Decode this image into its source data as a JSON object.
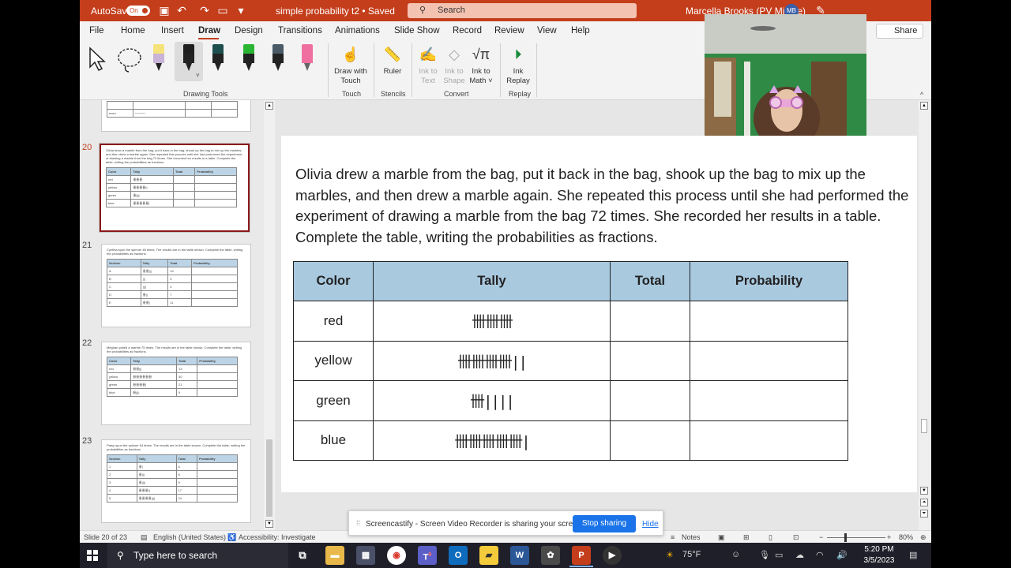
{
  "titlebar": {
    "autosave_label": "AutoSave",
    "autosave_state": "On",
    "doc_title": "simple probability t2 • Saved",
    "search_placeholder": "Search",
    "user_name": "Marcella Brooks (PV Middle)",
    "user_initials": "MB"
  },
  "menu": {
    "items": [
      "File",
      "Home",
      "Insert",
      "Draw",
      "Design",
      "Transitions",
      "Animations",
      "Slide Show",
      "Record",
      "Review",
      "View",
      "Help"
    ],
    "active": "Draw",
    "share_label": "Share"
  },
  "ribbon": {
    "groups": {
      "drawing_tools": "Drawing Tools",
      "touch": "Touch",
      "stencils": "Stencils",
      "convert": "Convert",
      "replay": "Replay"
    },
    "buttons": {
      "draw_with_touch": [
        "Draw with",
        "Touch"
      ],
      "ruler": "Ruler",
      "ink_to_text": [
        "Ink to",
        "Text"
      ],
      "ink_to_shape": [
        "Ink to",
        "Shape"
      ],
      "ink_to_math": [
        "Ink to",
        "Math ˅"
      ],
      "ink_replay": [
        "Ink",
        "Replay"
      ]
    },
    "pen_colors": [
      "#f6e27a",
      "#1f1f1f",
      "#1e4f4f",
      "#2bb534",
      "#4a5a66",
      "#ef6fa0"
    ]
  },
  "thumbnails": {
    "slide_19_partial": {
      "row_label": "even",
      "row_tally": "ꟷꟷꟷꟷ"
    },
    "slide_20": {
      "number": "20",
      "text": "Olivia drew a marble from the bag, put it back in the bag, shook up the bag to mix up the marbles, and then drew a marble again. She repeated this process until she had performed the experiment of drawing a marble from the bag 72 times. She recorded her results in a table. Complete the table, writing the probabilities as fractions.",
      "headers": [
        "Color",
        "Tally",
        "Total",
        "Probability"
      ],
      "rows": [
        "red",
        "yellow",
        "green",
        "blue"
      ]
    },
    "slide_21": {
      "number": "21",
      "text": "Cynthia spun the spinner 48 times. The results are in the table shown. Complete the table, writing the probabilities as fractions.",
      "headers": [
        "Section",
        "Tally",
        "Total",
        "Probability"
      ],
      "rows": [
        [
          "A",
          "13"
        ],
        [
          "B",
          "3"
        ],
        [
          "C",
          "4"
        ],
        [
          "D",
          "7"
        ],
        [
          "E",
          "11"
        ]
      ]
    },
    "slide_22": {
      "number": "22",
      "text": "Meghan pulled a marble 75 times. The results are in the table shown. Complete the table, writing the probabilities as fractions.",
      "headers": [
        "Color",
        "Tally",
        "Total",
        "Probability"
      ],
      "rows": [
        [
          "red",
          "13"
        ],
        [
          "yellow",
          "30"
        ],
        [
          "green",
          "21"
        ],
        [
          "blue",
          "9"
        ]
      ]
    },
    "slide_23": {
      "number": "23",
      "text": "Patsy spun the spinner 64 times. The results are in the table shown. Complete the table, writing the probabilities as fractions.",
      "headers": [
        "Section",
        "Tally",
        "Total",
        "Probability"
      ],
      "rows": [
        [
          "1",
          "6"
        ],
        [
          "2",
          "8"
        ],
        [
          "3",
          "9"
        ],
        [
          "4",
          "17"
        ],
        [
          "5",
          "24"
        ]
      ]
    }
  },
  "slide": {
    "prompt": "Olivia drew a marble from the bag, put it back in the bag, shook up the bag to mix up the marbles, and then drew a marble again. She repeated this process until she had performed the experiment of drawing a marble from the bag 72 times. She recorded her results in a table. Complete the table, writing the probabilities as fractions.",
    "headers": [
      "Color",
      "Tally",
      "Total",
      "Probability"
    ],
    "rows": [
      {
        "color": "red",
        "tally": "卌卌卌",
        "total": "",
        "probability": ""
      },
      {
        "color": "yellow",
        "tally": "卌卌卌卌||",
        "total": "",
        "probability": ""
      },
      {
        "color": "green",
        "tally": "卌||||",
        "total": "",
        "probability": ""
      },
      {
        "color": "blue",
        "tally": "卌卌卌卌卌|",
        "total": "",
        "probability": ""
      }
    ],
    "header_color": "#a9c9df"
  },
  "statusbar": {
    "slide_counter": "Slide 20 of 23",
    "language": "English (United States)",
    "accessibility": "Accessibility: Investigate",
    "notes": "Notes",
    "zoom": "80%"
  },
  "share_banner": {
    "message": "Screencastify - Screen Video Recorder is sharing your screen.",
    "stop_label": "Stop sharing",
    "hide_label": "Hide"
  },
  "taskbar": {
    "search_placeholder": "Type here to search",
    "weather": "75°F",
    "time": "5:20 PM",
    "date": "3/5/2023",
    "teams_badge": "9"
  },
  "colors": {
    "accent": "#c43e1c",
    "selected_thumb_border": "#8a1a1a",
    "banner_button": "#1a73e8"
  }
}
